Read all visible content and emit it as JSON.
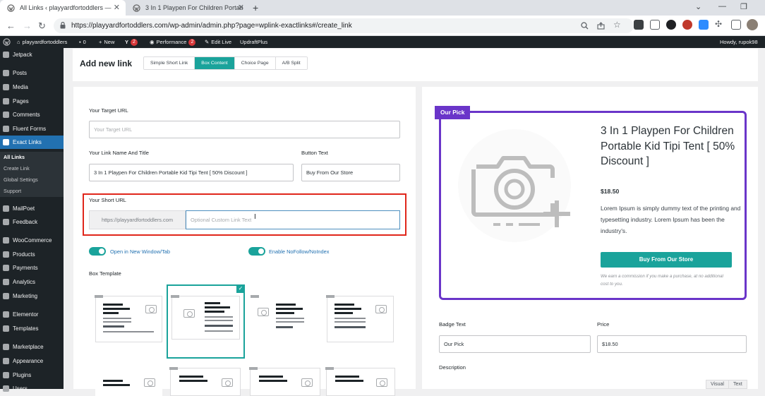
{
  "browser": {
    "tabs": [
      {
        "title": "All Links ‹ playyardfortoddlers —",
        "active": true
      },
      {
        "title": "3 In 1 Playpen For Children Portab",
        "active": false
      }
    ],
    "url": "https://playyardfortoddlers.com/wp-admin/admin.php?page=wplink-exactlinks#/create_link"
  },
  "adminbar": {
    "site": "playyardfortoddlers",
    "comments": "0",
    "new": "New",
    "yoast_count": "2",
    "performance": "Performance",
    "performance_count": "2",
    "edit_live": "Edit Live",
    "updraft": "UpdraftPlus",
    "howdy": "Howdy, rupok98"
  },
  "sidebar": {
    "items": [
      {
        "label": "Jetpack"
      },
      {
        "label": "Posts"
      },
      {
        "label": "Media"
      },
      {
        "label": "Pages"
      },
      {
        "label": "Comments"
      },
      {
        "label": "Fluent Forms"
      },
      {
        "label": "Exact Links"
      },
      {
        "label": "MailPoet"
      },
      {
        "label": "Feedback"
      },
      {
        "label": "WooCommerce"
      },
      {
        "label": "Products"
      },
      {
        "label": "Payments"
      },
      {
        "label": "Analytics"
      },
      {
        "label": "Marketing"
      },
      {
        "label": "Elementor"
      },
      {
        "label": "Templates"
      },
      {
        "label": "Marketplace"
      },
      {
        "label": "Appearance"
      },
      {
        "label": "Plugins"
      },
      {
        "label": "Users"
      }
    ],
    "submenu": [
      "All Links",
      "Create Link",
      "Global Settings",
      "Support"
    ]
  },
  "header": {
    "title": "Add new link",
    "tabs": [
      "Simple Short Link",
      "Box Content",
      "Choice Page",
      "A/B Split"
    ]
  },
  "form": {
    "target_url_label": "Your Target URL",
    "target_url_placeholder": "Your Target URL",
    "link_name_label": "Your Link Name And Title",
    "link_name_value": "3 In 1 Playpen For Children Portable Kid Tipi Tent [ 50% Discount ]",
    "button_text_label": "Button Text",
    "button_text_value": "Buy From Our Store",
    "short_url_label": "Your Short URL",
    "short_url_prefix": "https://playyardfortoddlers.com",
    "short_url_placeholder": "Optional Custom Link Text",
    "toggle_new_window": "Open in New Window/Tab",
    "toggle_nofollow": "Enable NoFollow/NoIndex",
    "box_template_label": "Box Template"
  },
  "preview": {
    "badge": "Our Pick",
    "title": "3 In 1 Playpen For Children Portable Kid Tipi Tent [ 50% Discount ]",
    "price": "$18.50",
    "description": "Lorem Ipsum is simply dummy text of the printing and typesetting industry. Lorem Ipsum has been the industry's.",
    "button": "Buy From Our Store",
    "disclaimer": "We earn a commission if you make a purchase, at no additional cost to you."
  },
  "preview_form": {
    "badge_label": "Badge Text",
    "badge_value": "Our Pick",
    "price_label": "Price",
    "price_value": "$18.50",
    "description_label": "Description",
    "visual_tab": "Visual",
    "text_tab": "Text"
  },
  "colors": {
    "accent": "#1aa39b",
    "preview_border": "#6a35c9",
    "highlight": "#e0261b",
    "admin_dark": "#1d2327",
    "wp_blue": "#2271b1"
  }
}
